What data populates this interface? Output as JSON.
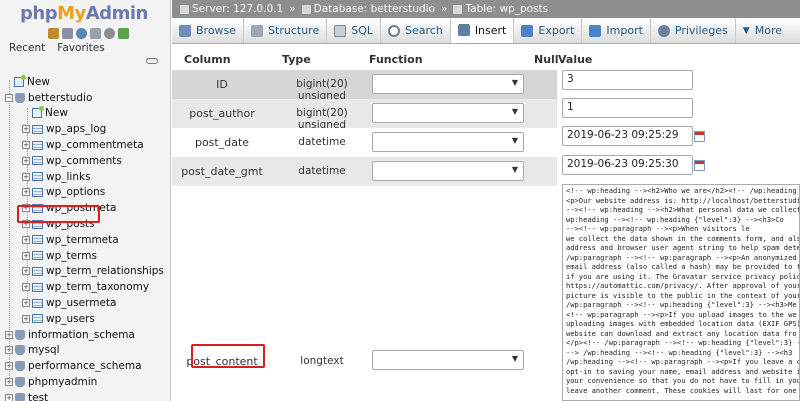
{
  "logo": {
    "php": "php",
    "my": "My",
    "admin": "Admin"
  },
  "nav_tabs": {
    "recent": "Recent",
    "favorites": "Favorites"
  },
  "tree": {
    "new_top": "New",
    "db_betterstudio": "betterstudio",
    "db_new": "New",
    "tables": [
      "wp_aps_log",
      "wp_commentmeta",
      "wp_comments",
      "wp_links",
      "wp_options",
      "wp_postmeta",
      "wp_posts",
      "wp_termmeta",
      "wp_terms",
      "wp_term_relationships",
      "wp_term_taxonomy",
      "wp_usermeta",
      "wp_users"
    ],
    "other_dbs": [
      "information_schema",
      "mysql",
      "performance_schema",
      "phpmyadmin",
      "test"
    ]
  },
  "breadcrumb": {
    "server": "Server: 127.0.0.1",
    "database": "Database: betterstudio",
    "table": "Table: wp_posts"
  },
  "tabs": [
    "Browse",
    "Structure",
    "SQL",
    "Search",
    "Insert",
    "Export",
    "Import",
    "Privileges",
    "More"
  ],
  "active_tab": "Insert",
  "columns_header": {
    "column": "Column",
    "type": "Type",
    "function": "Function",
    "null": "Null",
    "value": "Value"
  },
  "rows": [
    {
      "column": "ID",
      "type": "bigint(20) unsigned",
      "value": "3"
    },
    {
      "column": "post_author",
      "type": "bigint(20) unsigned",
      "value": "1"
    },
    {
      "column": "post_date",
      "type": "datetime",
      "value": "2019-06-23 09:25:29"
    },
    {
      "column": "post_date_gmt",
      "type": "datetime",
      "value": "2019-06-23 09:25:30"
    },
    {
      "column": "post_content",
      "type": "longtext"
    }
  ],
  "post_content_value": "<!-- wp:heading --><h2>Who we are</h2><!-- /wp:heading\n<p>Our website address is: http://localhost/betterstudi\n--><!-- wp:heading --><h2>What personal data we collect\nwp:heading --><!-- wp:heading {\"level\":3} --><h3>Co\n--><!-- wp:paragraph --><p>When visitors le\nwe collect the data shown in the comments form, and als\naddress and browser user agent string to help spam dete\n/wp:paragraph --><!-- wp:paragraph --><p>An anonymized\nemail address (also called a hash) may be provided to t\nif you are using it. The Gravatar service privacy polic\nhttps://automattic.com/privacy/. After approval of your\npicture is visible to the public in the context of your\n/wp:paragraph --><!-- wp:heading {\"level\":3} --><h3>Me\n<!-- wp:paragraph --><p>If you upload images to the we\nuploading images with embedded location data (EXIF GPS)\nwebsite can download and extract any location data fro\n</p><!-- /wp:paragraph --><!-- wp:heading {\"level\":3} -\n--> /wp:heading --><!-- wp:heading {\"level\":3} --><h3\n/wp:heading --><!-- wp:paragraph --><p>If you leave a c\nopt-in to saving your name, email address and website i\nyour convenience so that you do not have to fill in you\nleave another comment. These cookies will last for one",
  "colors": {
    "highlight": "#d92020",
    "breadcrumb_bg": "#8e8e8e",
    "row_alt": "#e5e5e5",
    "row_header": "#d6d6d6",
    "link": "#235a81"
  }
}
